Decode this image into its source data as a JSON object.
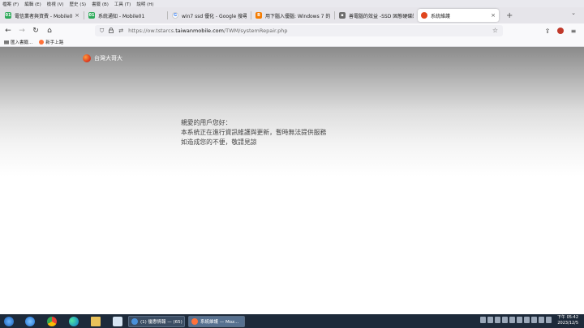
{
  "menu": [
    "檔案 (F)",
    "編輯 (E)",
    "檢視 (V)",
    "歷史 (S)",
    "書籤 (B)",
    "工具 (T)",
    "說明 (H)"
  ],
  "tabs": [
    {
      "label": "電信業者與資費 - Mobile01",
      "favicon_color": "#2eaa5a",
      "favicon_glyph": "01"
    },
    {
      "label": "系統通知 - Mobile01",
      "favicon_color": "#2eaa5a",
      "favicon_glyph": "01"
    },
    {
      "label": "win7 ssd 優化 - Google 搜尋",
      "favicon_color": "#ffffff",
      "favicon_glyph": "G"
    },
    {
      "label": "用下腦入優腦: Windows 7 的 S",
      "favicon_color": "#f57c00",
      "favicon_glyph": "B"
    },
    {
      "label": "善電腦的效益 -SSD 固態硬碟的",
      "favicon_color": "#6b6b6b",
      "favicon_glyph": "▪"
    },
    {
      "label": "系統維護",
      "favicon_color": "#e0451d",
      "favicon_glyph": "●",
      "active": true
    }
  ],
  "newtab_glyph": "+",
  "listtabs_glyph": "⌄",
  "nav": {
    "back": "←",
    "forward": "→",
    "reload": "↻",
    "home": "⌂"
  },
  "urlbar": {
    "scheme_host_prefix": "https://ow.tstarcs.",
    "host": "taiwanmobile.com",
    "path": "/TWM/systemRepair.php"
  },
  "bookmarks": [
    {
      "label": "匯入書籤..."
    },
    {
      "label": "新手上路"
    }
  ],
  "page": {
    "logo_text": "台灣大哥大",
    "message": [
      "親愛的用戶您好：",
      "本系統正在進行資訊維護與更新，暫時無法提供服務",
      "如造成您的不便，敬請見諒"
    ]
  },
  "taskbar": {
    "items": [
      {
        "label": "(1) 優惠情報 — (65)",
        "icon_color": "#4a90d9"
      },
      {
        "label": "系統維護 — Moz...",
        "icon_color": "#ff7139",
        "active": true
      }
    ],
    "clock_time": "下午 05:42",
    "clock_date": "2023/12/5"
  }
}
